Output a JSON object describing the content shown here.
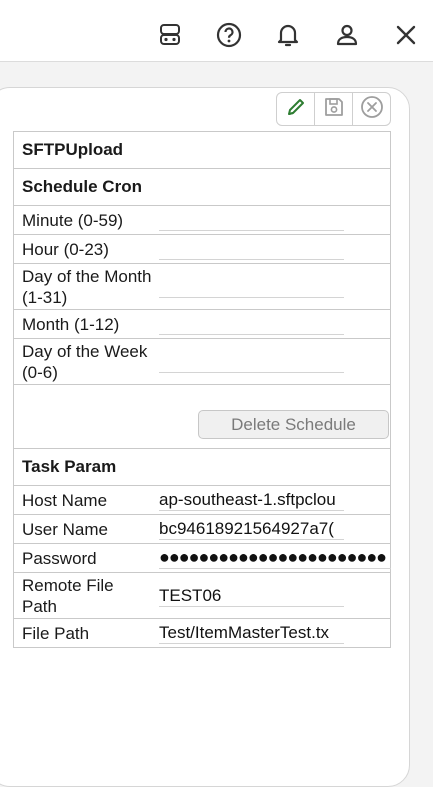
{
  "topbar": {
    "icons": [
      "robot-icon",
      "help-circle-icon",
      "bell-icon",
      "user-icon",
      "close-icon"
    ]
  },
  "toolbar": {
    "icons": [
      "edit-pencil-icon",
      "save-disk-icon",
      "cancel-circle-icon"
    ]
  },
  "form": {
    "task_name": "SFTPUpload",
    "schedule_header": "Schedule Cron",
    "schedule_fields": [
      {
        "label": "Minute (0-59)",
        "value": ""
      },
      {
        "label": "Hour (0-23)",
        "value": ""
      },
      {
        "label": "Day of the Month (1-31)",
        "value": ""
      },
      {
        "label": "Month (1-12)",
        "value": ""
      },
      {
        "label": "Day of the Week (0-6)",
        "value": ""
      }
    ],
    "delete_label": "Delete Schedule",
    "param_header": "Task Param",
    "params": [
      {
        "label": "Host Name",
        "value": "ap-southeast-1.sftpclou"
      },
      {
        "label": "User Name",
        "value": "bc94618921564927a7("
      },
      {
        "label": "Password",
        "value": "●●●●●●●●●●●●●●●●●●●●●●●"
      },
      {
        "label": "Remote File Path",
        "value": "TEST06"
      },
      {
        "label": "File Path",
        "value": "Test/ItemMasterTest.tx"
      }
    ]
  },
  "colors": {
    "pencil": "#2e7d32",
    "disabled": "#9e9e9e"
  }
}
